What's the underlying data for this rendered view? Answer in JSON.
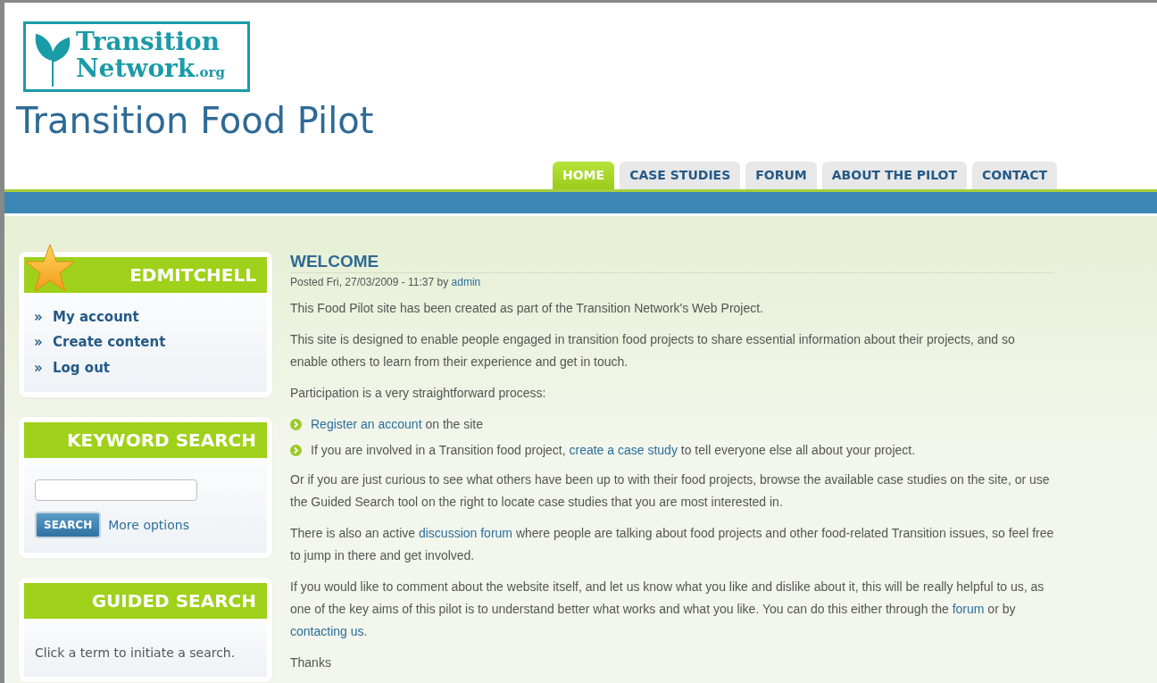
{
  "logo": {
    "line1": "Transition",
    "line2": "Network",
    "suffix": ".org"
  },
  "site_title": "Transition Food Pilot",
  "tabs": [
    {
      "label": "HOME",
      "selected": true
    },
    {
      "label": "CASE STUDIES",
      "selected": false
    },
    {
      "label": "FORUM",
      "selected": false
    },
    {
      "label": "ABOUT THE PILOT",
      "selected": false
    },
    {
      "label": "CONTACT",
      "selected": false
    }
  ],
  "sidebar": [
    {
      "kind": "user",
      "title": "EDMITCHELL",
      "links": [
        "My account",
        "Create content",
        "Log out"
      ]
    },
    {
      "kind": "search",
      "title": "KEYWORD SEARCH",
      "button": "SEARCH",
      "more": "More options"
    },
    {
      "kind": "text",
      "title": "GUIDED SEARCH",
      "text": "Click a term to initiate a search."
    }
  ],
  "article": {
    "title": "WELCOME",
    "posted": "Posted Fri, 27/03/2009 - 11:37 by",
    "author": "admin",
    "blocks": [
      {
        "kind": "para",
        "parts": [
          {
            "text": "This Food Pilot site has been created as part of the Transition Network's Web Project.",
            "link": false
          }
        ]
      },
      {
        "kind": "para",
        "parts": [
          {
            "text": "This site is designed to enable people engaged in transition food projects to share essential information about their projects, and so enable others to learn from their experience and get in touch.",
            "link": false
          }
        ]
      },
      {
        "kind": "para",
        "parts": [
          {
            "text": "Participation is a very straightforward process:",
            "link": false
          }
        ]
      },
      {
        "kind": "list",
        "items": [
          [
            {
              "text": "Register an account",
              "link": true
            },
            {
              "text": " on the site",
              "link": false
            }
          ],
          [
            {
              "text": "If you are involved in a Transition food project, ",
              "link": false
            },
            {
              "text": "create a case study",
              "link": true
            },
            {
              "text": " to tell everyone else all about your project.",
              "link": false
            }
          ]
        ]
      },
      {
        "kind": "para",
        "parts": [
          {
            "text": "Or if you are just curious to see what others have been up to with their food projects, browse the available case studies on the site, or use the Guided Search tool on the right to locate case studies that you are most interested in.",
            "link": false
          }
        ]
      },
      {
        "kind": "para",
        "parts": [
          {
            "text": "There is also an active ",
            "link": false
          },
          {
            "text": "discussion forum",
            "link": true
          },
          {
            "text": " where people are talking about food projects and other food-related Transition issues, so feel free to jump in there and get involved.",
            "link": false
          }
        ]
      },
      {
        "kind": "para",
        "parts": [
          {
            "text": "If you would like to comment about the website itself, and let us know what you like and dislike about it, this will be really helpful to us, as one of the key aims of this pilot is to understand better what works and what you like. You can do this either through the ",
            "link": false
          },
          {
            "text": "forum",
            "link": true
          },
          {
            "text": " or by ",
            "link": false
          },
          {
            "text": "contacting us",
            "link": true
          },
          {
            "text": ".",
            "link": false
          }
        ]
      },
      {
        "kind": "para",
        "parts": [
          {
            "text": "Thanks",
            "link": false
          }
        ]
      }
    ]
  }
}
